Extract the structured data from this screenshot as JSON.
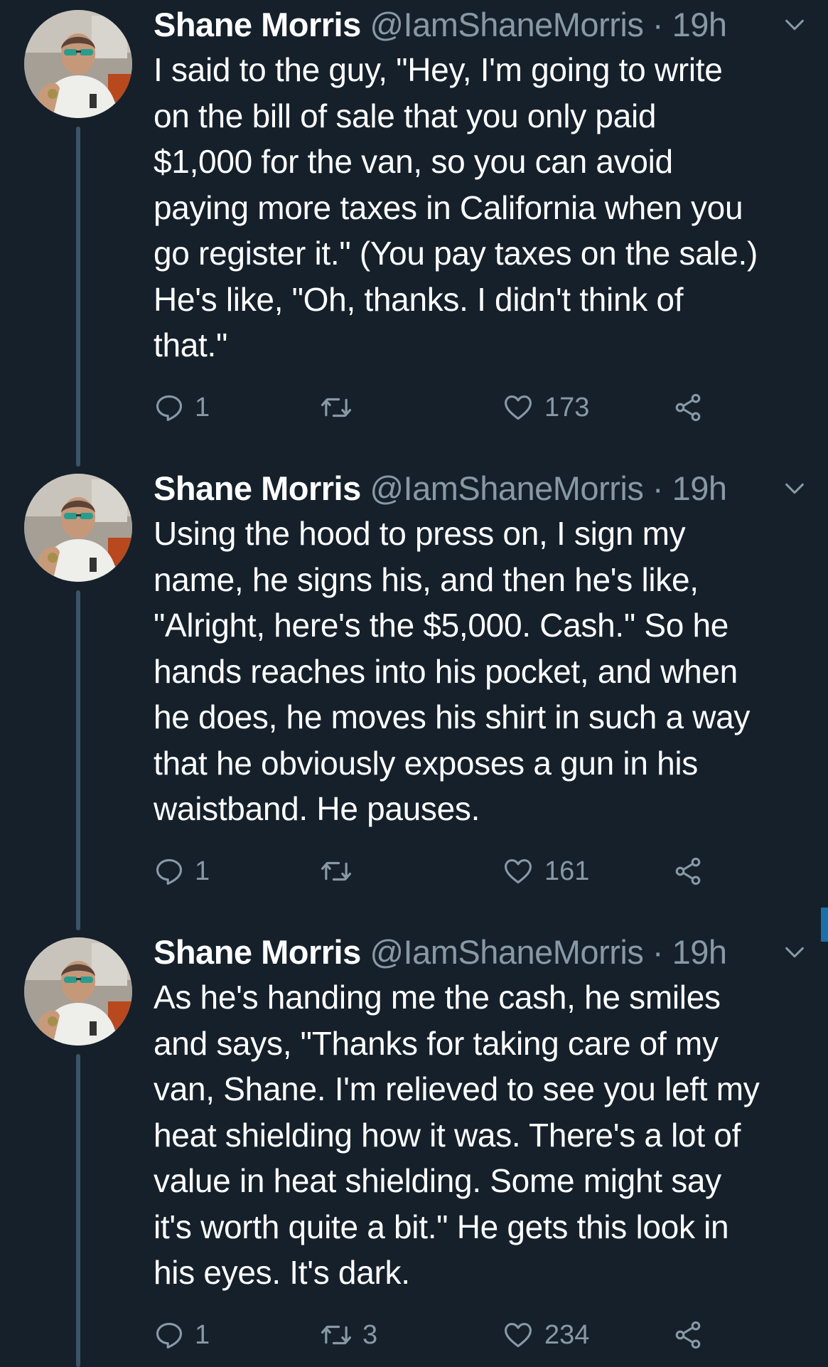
{
  "colors": {
    "background": "#15202b",
    "secondary_text": "#8899a6",
    "thread_line": "#3d5466",
    "scrollbar": "#1d6fa5"
  },
  "tweets": [
    {
      "author_name": "Shane Morris",
      "handle": "@IamShaneMorris",
      "separator": "·",
      "time": "19h",
      "lines": [
        "I said to the guy, \"Hey, I'm going to write",
        "on the bill of sale that you only paid",
        "$1,000 for the van, so you can avoid",
        "paying more taxes in California when you",
        "go register it.\" (You pay taxes on the sale.)",
        "He's like, \"Oh, thanks. I didn't think of",
        "that.\""
      ],
      "replies": "1",
      "retweets": "",
      "likes": "173",
      "icons": [
        "reply-icon",
        "retweet-icon",
        "like-icon",
        "share-icon",
        "chevron-down-icon"
      ]
    },
    {
      "author_name": "Shane Morris",
      "handle": "@IamShaneMorris",
      "separator": "·",
      "time": "19h",
      "lines": [
        "Using the hood to press on, I sign my",
        "name, he signs his, and then he's like,",
        "\"Alright, here's the $5,000. Cash.\" So he",
        "hands reaches into his pocket, and when",
        "he does, he moves his shirt in such a way",
        "that he obviously exposes a gun in his",
        "waistband. He pauses."
      ],
      "replies": "1",
      "retweets": "",
      "likes": "161",
      "icons": [
        "reply-icon",
        "retweet-icon",
        "like-icon",
        "share-icon",
        "chevron-down-icon"
      ]
    },
    {
      "author_name": "Shane Morris",
      "handle": "@IamShaneMorris",
      "separator": "·",
      "time": "19h",
      "lines": [
        "As he's handing me the cash, he smiles",
        "and says, \"Thanks for taking care of my",
        "van, Shane. I'm relieved to see you left my",
        "heat shielding how it was. There's a lot of",
        "value in heat shielding. Some might say",
        "it's worth quite a bit.\" He gets this look in",
        "his eyes. It's dark."
      ],
      "replies": "1",
      "retweets": "3",
      "likes": "234",
      "icons": [
        "reply-icon",
        "retweet-icon",
        "like-icon",
        "share-icon",
        "chevron-down-icon"
      ]
    }
  ]
}
